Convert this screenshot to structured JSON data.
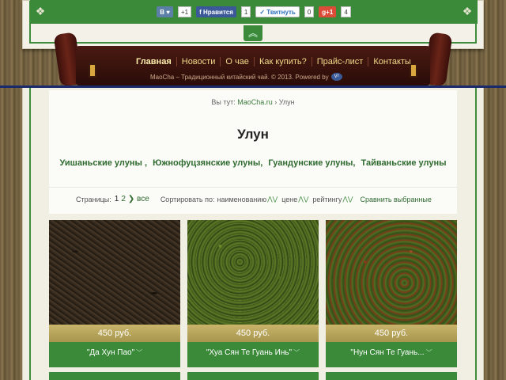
{
  "share": {
    "vk_label": "В",
    "vk_heart": "♥",
    "vk_count": "+1",
    "fb_label": "Нравится",
    "fb_count": "1",
    "tw_label": "Твитнуть",
    "tw_count": "0",
    "gp_label": "g+1",
    "gp_count": "4"
  },
  "toggle_icon": "chevron-up-icon",
  "nav": {
    "items": [
      {
        "label": "Главная",
        "active": true
      },
      {
        "label": "Новости"
      },
      {
        "label": "О чае"
      },
      {
        "label": "Как купить?"
      },
      {
        "label": "Прайс-лист"
      },
      {
        "label": "Контакты"
      }
    ],
    "footer_text": "MaoCha – Традиционный китайский чай. © 2013. Powered by",
    "footer_badge": "V²"
  },
  "breadcrumb": {
    "prefix": "Вы тут:",
    "home": "MaoCha.ru",
    "separator": "›",
    "current": "Улун"
  },
  "page_title": "Улун",
  "subcategories": [
    "Уишаньские улуны ,",
    "Южнофуцзянские улуны,",
    "Гуандунские улуны,",
    "Тайваньские улуны"
  ],
  "toolbar": {
    "pages_label": "Страницы:",
    "page_current": "1",
    "page_2": "2",
    "page_all": "❯ все",
    "sort_label": "Сортировать по:",
    "sort_name": "наименованию",
    "sort_price": "цене",
    "sort_rating": "рейтингу",
    "arrows": "⋀⋁",
    "compare": "Сравнить выбранные"
  },
  "products": [
    {
      "price": "450 руб.",
      "name": "\"Да Хун Пао\"",
      "chev": "﹀",
      "leaf": "dark"
    },
    {
      "price": "450 руб.",
      "name": "\"Хуа Сян Те Гуань Инь\"",
      "chev": "﹀",
      "leaf": "green"
    },
    {
      "price": "450 руб.",
      "name": "\"Нун Сян Те Гуань...",
      "chev": "﹀",
      "leaf": "oolong"
    }
  ],
  "colors": {
    "green": "#3a8a3a",
    "nav_text": "#f0d98a",
    "price_band": "#b8a55c"
  }
}
